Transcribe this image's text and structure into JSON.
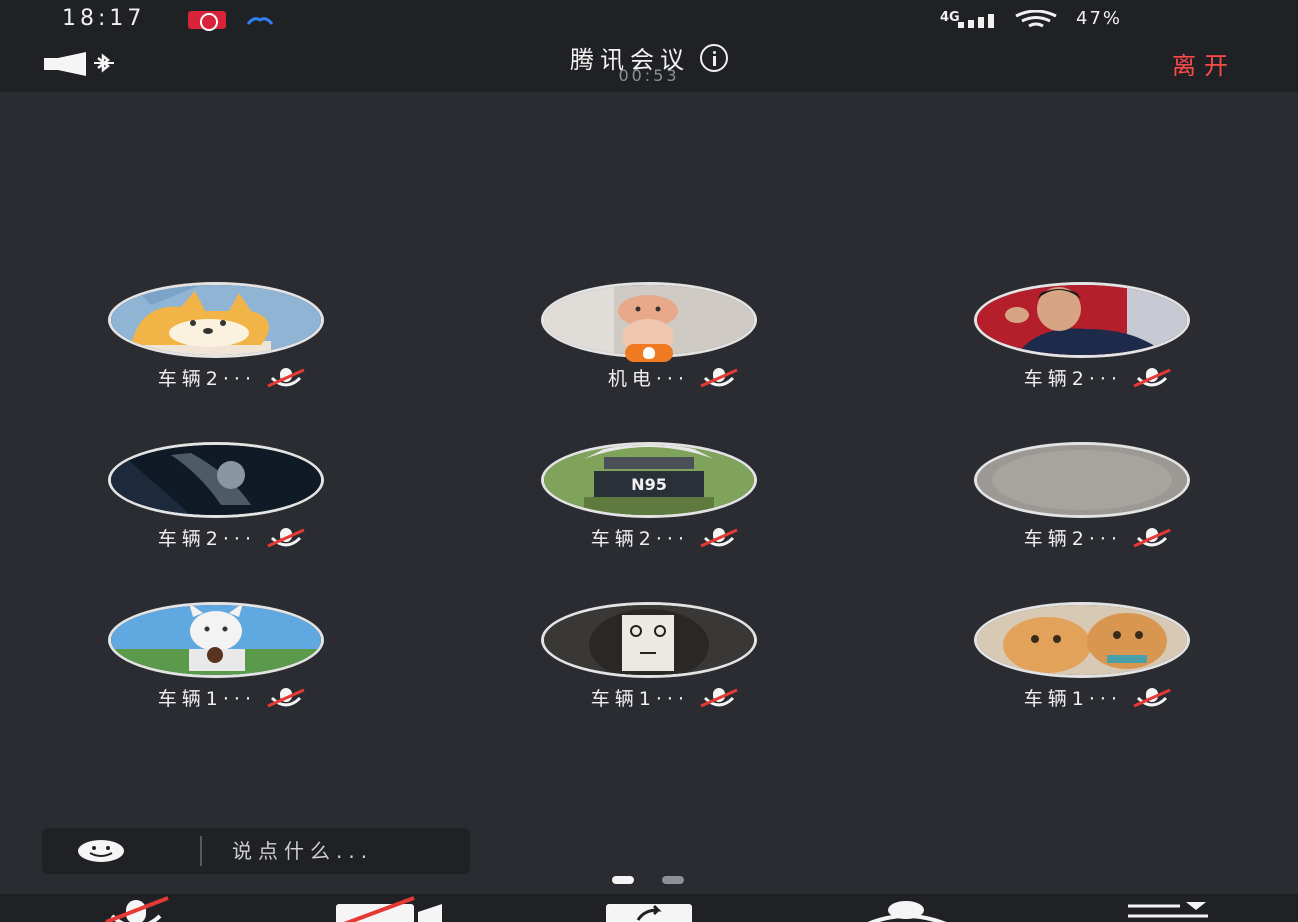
{
  "status_bar": {
    "time": "18:17",
    "network": "4G",
    "battery": "47%"
  },
  "header": {
    "title": "腾讯会议",
    "timer": "00:53",
    "leave_label": "离开"
  },
  "participants": [
    {
      "name": "车辆2···",
      "avatar": "corgi",
      "host": false
    },
    {
      "name": "机电···",
      "avatar": "pig-doll",
      "host": true
    },
    {
      "name": "车辆2···",
      "avatar": "man-red",
      "host": false
    },
    {
      "name": "车辆2···",
      "avatar": "dark-stage",
      "host": false
    },
    {
      "name": "车辆2···",
      "avatar": "ninja-n95",
      "host": false
    },
    {
      "name": "车辆2···",
      "avatar": "gray-blank",
      "host": false
    },
    {
      "name": "车辆1···",
      "avatar": "anime-dog",
      "host": false
    },
    {
      "name": "车辆1···",
      "avatar": "mask-face",
      "host": false
    },
    {
      "name": "车辆1···",
      "avatar": "cats",
      "host": false
    }
  ],
  "avatar_text": {
    "ninja": "N95"
  },
  "chat": {
    "placeholder": "说点什么..."
  },
  "pager": {
    "pages": 2,
    "active": 0
  },
  "colors": {
    "background": "#2a2c31",
    "bar": "#1f2125",
    "leave": "#ff4a4a",
    "mute_slash": "#e53935",
    "host_badge": "#f07a22"
  },
  "icons": {
    "speaker": "speaker-bluetooth-icon",
    "info": "info-icon",
    "mic_muted": "mic-muted-icon",
    "emoji": "emoji-icon"
  }
}
